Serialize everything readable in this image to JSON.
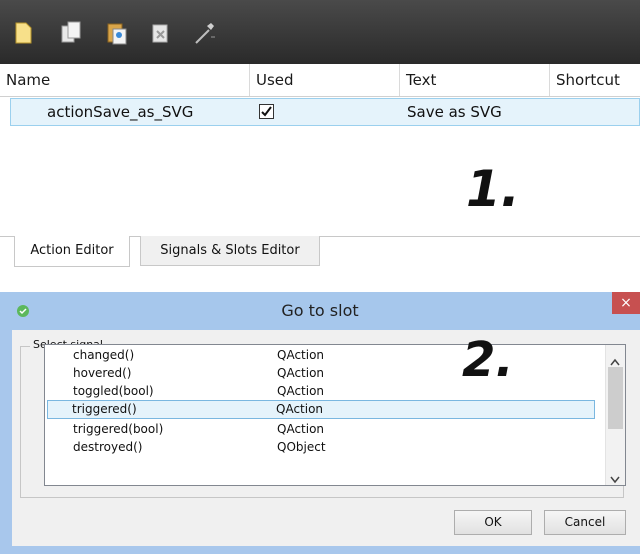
{
  "toolbar": {
    "buttons": [
      {
        "icon": "new-action-icon"
      },
      {
        "icon": "copy-icon"
      },
      {
        "icon": "paste-icon"
      },
      {
        "icon": "delete-icon"
      },
      {
        "icon": "configure-icon"
      }
    ]
  },
  "action_editor": {
    "columns": [
      "Name",
      "Used",
      "Text",
      "Shortcut"
    ],
    "rows": [
      {
        "name": "actionSave_as_SVG",
        "used": true,
        "text": "Save as SVG",
        "shortcut": ""
      }
    ],
    "marker": "1."
  },
  "tabs": [
    {
      "label": "Action Editor",
      "active": true
    },
    {
      "label": "Signals & Slots Editor",
      "active": false
    }
  ],
  "dialog": {
    "title": "Go to slot",
    "close_label": "×",
    "group_label": "Select signal",
    "marker": "2.",
    "signals": [
      {
        "signal": "changed()",
        "class": "QAction"
      },
      {
        "signal": "hovered()",
        "class": "QAction"
      },
      {
        "signal": "toggled(bool)",
        "class": "QAction"
      },
      {
        "signal": "triggered()",
        "class": "QAction",
        "selected": true
      },
      {
        "signal": "triggered(bool)",
        "class": "QAction"
      },
      {
        "signal": "destroyed()",
        "class": "QObject"
      }
    ],
    "ok_label": "OK",
    "cancel_label": "Cancel"
  }
}
